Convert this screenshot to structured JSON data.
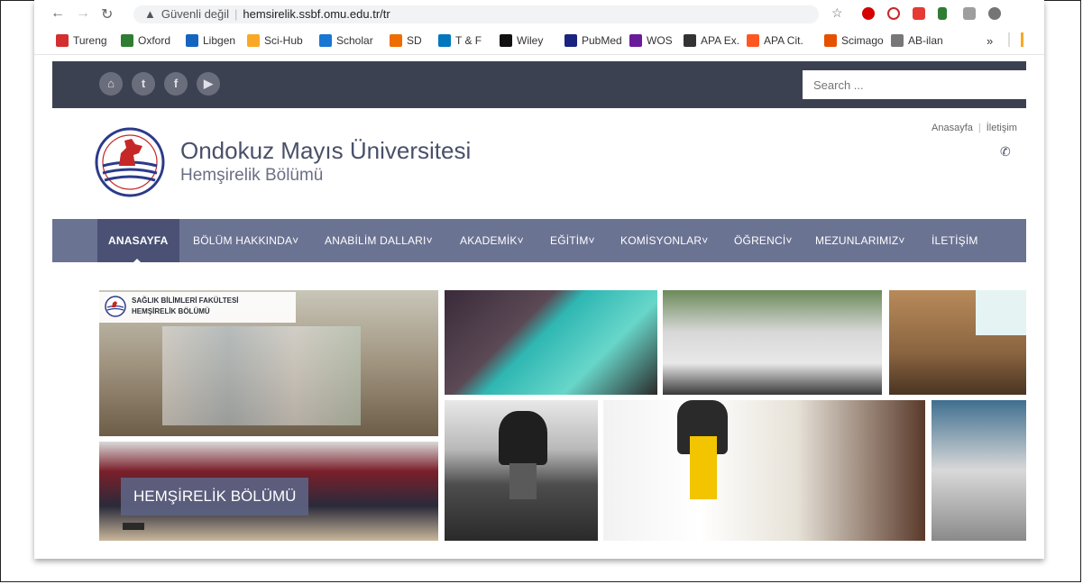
{
  "browser": {
    "address": {
      "security_label": "Güvenli değil",
      "url": "hemsirelik.ssbf.omu.edu.tr/tr"
    },
    "bookmarks": [
      {
        "label": "Tureng",
        "icon": "tureng-icon",
        "color": "#d32f2f"
      },
      {
        "label": "Oxford",
        "icon": "oxford-icon",
        "color": "#2e7d32"
      },
      {
        "label": "Libgen",
        "icon": "libgen-icon",
        "color": "#1565c0"
      },
      {
        "label": "Sci-Hub",
        "icon": "scihub-icon",
        "color": "#f9a825"
      },
      {
        "label": "Scholar",
        "icon": "scholar-icon",
        "color": "#1976d2"
      },
      {
        "label": "SD",
        "icon": "sciencedirect-icon",
        "color": "#ef6c00"
      },
      {
        "label": "T & F",
        "icon": "tandf-icon",
        "color": "#0277bd"
      },
      {
        "label": "Wiley",
        "icon": "wiley-icon",
        "color": "#111111"
      },
      {
        "label": "PubMed",
        "icon": "pubmed-icon",
        "color": "#1a237e"
      },
      {
        "label": "WOS",
        "icon": "wos-icon",
        "color": "#6a1b9a"
      },
      {
        "label": "APA Ex.",
        "icon": "apa-ex-icon",
        "color": "#333333"
      },
      {
        "label": "APA Cit.",
        "icon": "apa-cit-icon",
        "color": "#ff5722"
      },
      {
        "label": "Scimago",
        "icon": "scimago-icon",
        "color": "#e65100"
      },
      {
        "label": "AB-ilan",
        "icon": "ab-ilan-icon",
        "color": "#777777"
      }
    ],
    "more_label": "»"
  },
  "site": {
    "search": {
      "placeholder": "Search ..."
    },
    "social": [
      {
        "icon": "home-icon",
        "glyph": "⌂"
      },
      {
        "icon": "twitter-icon",
        "glyph": "t"
      },
      {
        "icon": "facebook-icon",
        "glyph": "f"
      },
      {
        "icon": "youtube-icon",
        "glyph": "▶"
      }
    ],
    "title": "Ondokuz Mayıs Üniversitesi",
    "subtitle": "Hemşirelik Bölümü",
    "top_links": {
      "home": "Anasayfa",
      "contact": "İletişim"
    },
    "nav": [
      {
        "label": "ANASAYFA",
        "active": true
      },
      {
        "label": "BÖLÜM HAKKINDA˅"
      },
      {
        "label": "ANABİLİM DALLARI˅"
      },
      {
        "label": "AKADEMİK˅"
      },
      {
        "label": "EĞİTİM˅"
      },
      {
        "label": "KOMİSYONLAR˅"
      },
      {
        "label": "ÖĞRENCİ˅"
      },
      {
        "label": "MEZUNLARIMIZ˅"
      },
      {
        "label": "İLETİŞİM"
      }
    ],
    "faculty_badge": {
      "line1": "SAĞLIK BİLİMLERİ FAKÜLTESİ",
      "line2": "HEMŞİRELİK BÖLÜMÜ"
    },
    "dept_label": "HEMŞİRELİK BÖLÜMÜ"
  },
  "colors": {
    "topbar": "#3c4152",
    "nav": "#6b7393",
    "nav_active": "#4a5174",
    "title": "#4a5069"
  }
}
